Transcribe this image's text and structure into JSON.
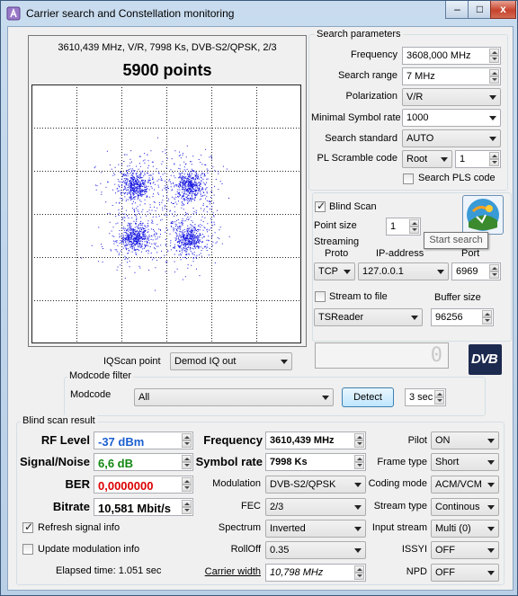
{
  "window": {
    "title": "Carrier search and Constellation monitoring",
    "minimize": "–",
    "maximize": "□",
    "close": "x"
  },
  "constellation": {
    "header": "3610,439 MHz, V/R, 7998 Ks, DVB-S2/QPSK, 2/3",
    "points_label": "5900 points",
    "point_color": "#1515e0"
  },
  "search_params": {
    "title": "Search parameters",
    "frequency_label": "Frequency",
    "frequency_value": "3608,000 MHz",
    "range_label": "Search range",
    "range_value": "7 MHz",
    "polarization_label": "Polarization",
    "polarization_value": "V/R",
    "min_sr_label": "Minimal Symbol rate",
    "min_sr_value": "1000",
    "standard_label": "Search standard",
    "standard_value": "AUTO",
    "pl_label": "PL Scramble code",
    "pl_mode": "Root",
    "pl_value": "1",
    "pls_label": "Search PLS code"
  },
  "blind": {
    "label": "Blind Scan",
    "point_size_label": "Point size",
    "point_size_value": "1",
    "tooltip": "Start search"
  },
  "streaming": {
    "label_line1": "Streaming",
    "label_line2": "Proto",
    "ip_label": "IP-address",
    "port_label": "Port",
    "proto": "TCP",
    "ip": "127.0.0.1",
    "port": "6969",
    "stream_file_label": "Stream to file",
    "buffer_label": "Buffer size",
    "app": "TSReader",
    "buffer_value": "96256"
  },
  "counter": "0",
  "logo": "DVB",
  "iqscan": {
    "label": "IQScan point",
    "value": "Demod IQ out"
  },
  "modcode": {
    "group": "Modcode filter",
    "label": "Modcode",
    "value": "All",
    "detect": "Detect",
    "time": "3 sec"
  },
  "result": {
    "title": "Blind scan result",
    "rf_label": "RF Level",
    "rf_value": "-37 dBm",
    "sn_label": "Signal/Noise",
    "sn_value": "6,6 dB",
    "ber_label": "BER",
    "ber_value": "0,0000000",
    "bitrate_label": "Bitrate",
    "bitrate_value": "10,581 Mbit/s",
    "freq_label": "Frequency",
    "freq_value": "3610,439 MHz",
    "sr_label": "Symbol rate",
    "sr_value": "7998 Ks",
    "mod_label": "Modulation",
    "mod_value": "DVB-S2/QPSK",
    "fec_label": "FEC",
    "fec_value": "2/3",
    "spectrum_label": "Spectrum",
    "spectrum_value": "Inverted",
    "rolloff_label": "RollOff",
    "rolloff_value": "0.35",
    "cw_label": "Carrier width",
    "cw_value": "10,798 MHz",
    "pilot_label": "Pilot",
    "pilot_value": "ON",
    "frame_label": "Frame type",
    "frame_value": "Short",
    "coding_label": "Coding mode",
    "coding_value": "ACM/VCM",
    "stream_label": "Stream type",
    "stream_value": "Continous",
    "input_label": "Input stream",
    "input_value": "Multi (0)",
    "issyi_label": "ISSYI",
    "issyi_value": "OFF",
    "npd_label": "NPD",
    "npd_value": "OFF",
    "refresh_label": "Refresh signal info",
    "update_label": "Update modulation info",
    "elapsed": "Elapsed time: 1.051 sec",
    "rf_color": "#1a5fd0",
    "sn_color": "#118811",
    "ber_color": "#dd0000"
  }
}
